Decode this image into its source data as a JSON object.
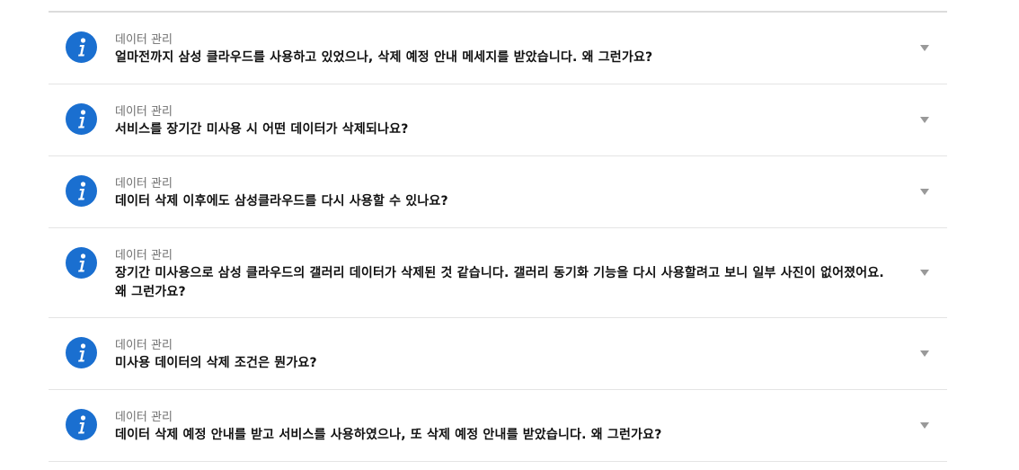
{
  "faq": {
    "items": [
      {
        "category": "데이터 관리",
        "question": "얼마전까지 삼성 클라우드를 사용하고 있었으나, 삭제 예정 안내 메세지를 받았습니다. 왜 그런가요?",
        "icon": "info-icon",
        "expand_icon": "chevron-down-icon"
      },
      {
        "category": "데이터 관리",
        "question": "서비스를 장기간 미사용 시 어떤 데이터가 삭제되나요?",
        "icon": "info-icon",
        "expand_icon": "chevron-down-icon"
      },
      {
        "category": "데이터 관리",
        "question": "데이터 삭제 이후에도 삼성클라우드를 다시 사용할 수 있나요?",
        "icon": "info-icon",
        "expand_icon": "chevron-down-icon"
      },
      {
        "category": "데이터 관리",
        "question": "장기간 미사용으로 삼성 클라우드의 갤러리 데이터가 삭제된 것 같습니다. 갤러리 동기화 기능을 다시 사용할려고 보니 일부 사진이 없어졌어요. 왜 그런가요?",
        "icon": "info-icon",
        "expand_icon": "chevron-down-icon"
      },
      {
        "category": "데이터 관리",
        "question": "미사용 데이터의 삭제 조건은 뭔가요?",
        "icon": "info-icon",
        "expand_icon": "chevron-down-icon"
      },
      {
        "category": "데이터 관리",
        "question": "데이터 삭제 예정 안내를 받고 서비스를 사용하였으나, 또 삭제 예정 안내를 받았습니다. 왜 그런가요?",
        "icon": "info-icon",
        "expand_icon": "chevron-down-icon"
      }
    ]
  },
  "colors": {
    "icon_blue": "#1a6fd0",
    "divider": "#e4e4e4",
    "category_text": "#707070",
    "question_text": "#111111",
    "chevron": "#999999"
  }
}
